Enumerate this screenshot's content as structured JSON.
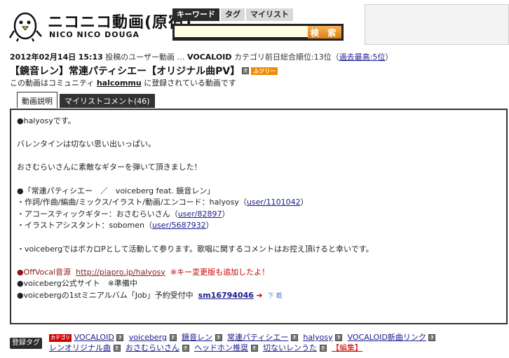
{
  "header": {
    "logo_main": "ニコニコ動画(原宿)",
    "logo_sub": "NICO NICO DOUGA",
    "search_tabs": [
      "キーワード",
      "タグ",
      "マイリスト"
    ],
    "search_value": "",
    "search_button": "検 索"
  },
  "meta": {
    "date": "2012年02月14日",
    "time": "15:13",
    "posted_text": "投稿のユーザー動画",
    "sep": "…",
    "category": "VOCALOID",
    "rank_text": "カテゴリ前日総合順位:13位（",
    "best_rank": "過去最高:5位",
    "rank_close": "）"
  },
  "title": "【鏡音レン】常連パティシエー【オリジナル曲PV】",
  "title_badge": "ふツリー",
  "community": {
    "pre": "この動画はコミュニティ",
    "name": "halcommu",
    "post": "に登録されている動画です"
  },
  "tabs": [
    "動画説明",
    "マイリストコメント(46)"
  ],
  "description": {
    "l1": "●halyosyです。",
    "l2": "バレンタインは切ない思い出いっぱい。",
    "l3": "おさむらいさんに素敵なギターを弾いて頂きました！",
    "l4": "●「常連パティシエー　／　voiceberg feat. 鏡音レン」",
    "l5_pre": "・作詞/作曲/編曲/ミックス/イラスト/動画/エンコード：halyosy（",
    "l5_link": "user/1101042",
    "l5_post": "）",
    "l6_pre": "・アコースティックギター：おさむらいさん（",
    "l6_link": "user/82897",
    "l6_post": "）",
    "l7_pre": "・イラストアシスタント：sobomen（",
    "l7_link": "user/5687932",
    "l7_post": "）",
    "l8": "・voicebergではボカロPとして活動して参ります。歌唱に関するコメントはお控え頂けると幸いです。",
    "l9_dot": "●",
    "l9_label": "OffVocal音源",
    "l9_url": "http://piapro.jp/halyosy",
    "l9_note": "※キー変更版も追加したよ！",
    "l10": "●voiceberg公式サイト　※準備中",
    "l11_pre": "●voicebergの1stミニアルバム「Job」予約受付中",
    "l11_sm": "sm16794046",
    "l11_arrow": "➜",
    "l11_dl": "下 載"
  },
  "tags": {
    "label": "登録タグ",
    "category_badge": "カテゴリ",
    "items": [
      "VOCALOID",
      "voiceberg",
      "鏡音レン",
      "常連パティシエー",
      "halyosy",
      "VOCALOID新曲リンク",
      "レンオリジナル曲",
      "おさむらいさん",
      "ヘッドホン推奨",
      "切ないレンうた"
    ],
    "edit": "【編集】"
  },
  "colors": {
    "accent_orange": "#e07d12",
    "link": "#1a1a8c",
    "dark": "#2b2b2b"
  }
}
